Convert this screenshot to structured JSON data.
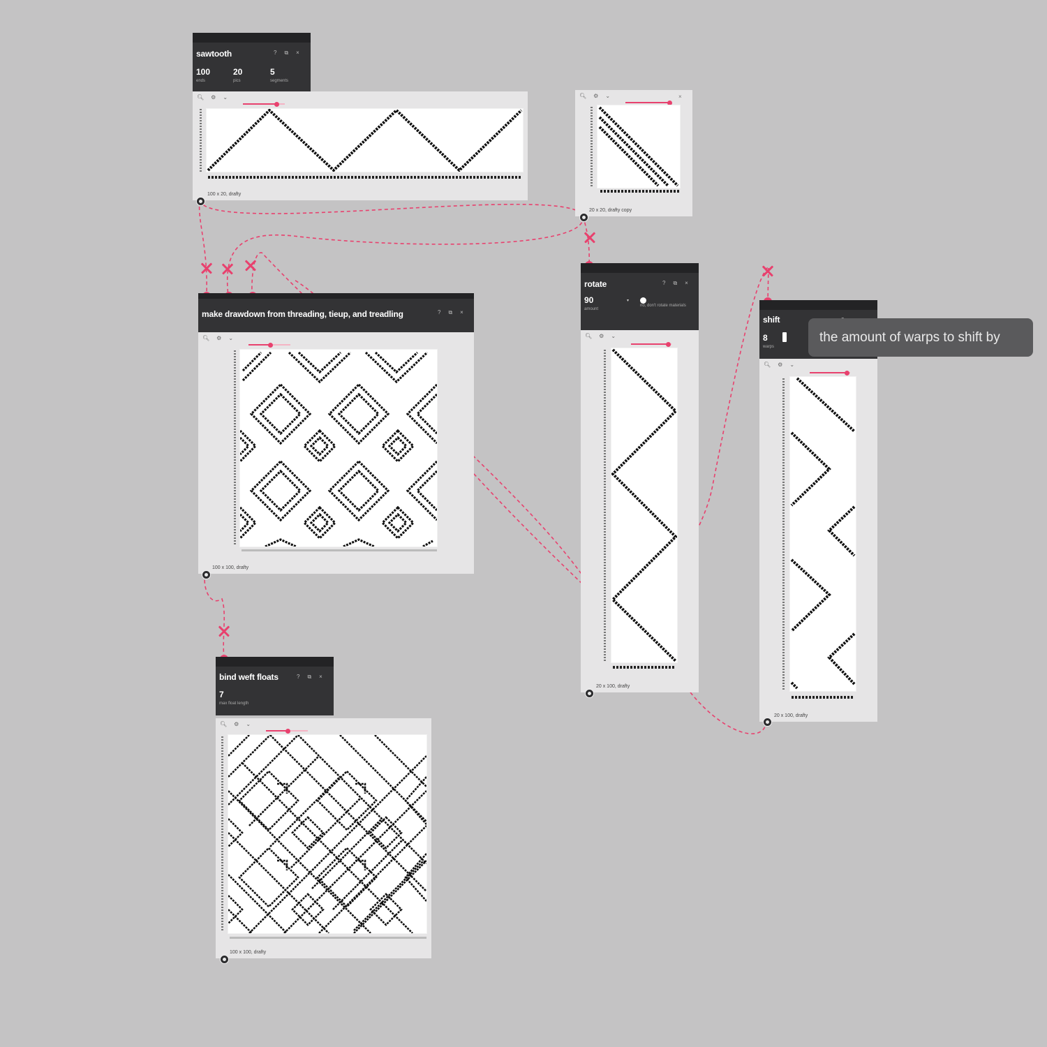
{
  "operations": {
    "sawtooth": {
      "title": "sawtooth",
      "params": [
        {
          "value": "100",
          "label": "ends"
        },
        {
          "value": "20",
          "label": "pics"
        },
        {
          "value": "5",
          "label": "segments"
        }
      ],
      "draft_info": "100 x 20, drafty"
    },
    "sawtooth_copy": {
      "draft_info": "20 x 20, drafty copy"
    },
    "drawdown": {
      "title": "make drawdown from threading, tieup, and treadling",
      "draft_info": "100 x 100, drafty"
    },
    "rotate": {
      "title": "rotate",
      "params": [
        {
          "value": "90",
          "label": "amount"
        },
        {
          "value": "",
          "label": "no, don't rotate materials"
        }
      ],
      "draft_info": "20 x 100, drafty"
    },
    "shift": {
      "title": "shift",
      "params": [
        {
          "value": "8",
          "label": "warps"
        }
      ],
      "draft_info": "20 x 100, drafty"
    },
    "bind": {
      "title": "bind weft floats",
      "params": [
        {
          "value": "7",
          "label": "max float length"
        }
      ],
      "draft_info": "100 x 100, drafty"
    }
  },
  "tooltip": "the amount of warps to shift by",
  "icons": {
    "zoom": "magnifier-icon",
    "settings": "gear-icon",
    "collapse": "chevron-icon",
    "close": "close-icon",
    "duplicate": "copy-icon",
    "info": "info-icon",
    "delete_connection": "x-icon"
  },
  "colors": {
    "accent": "#e8416e",
    "op_header": "#333335",
    "canvas": "#c4c3c4",
    "panel": "#e6e5e6"
  }
}
